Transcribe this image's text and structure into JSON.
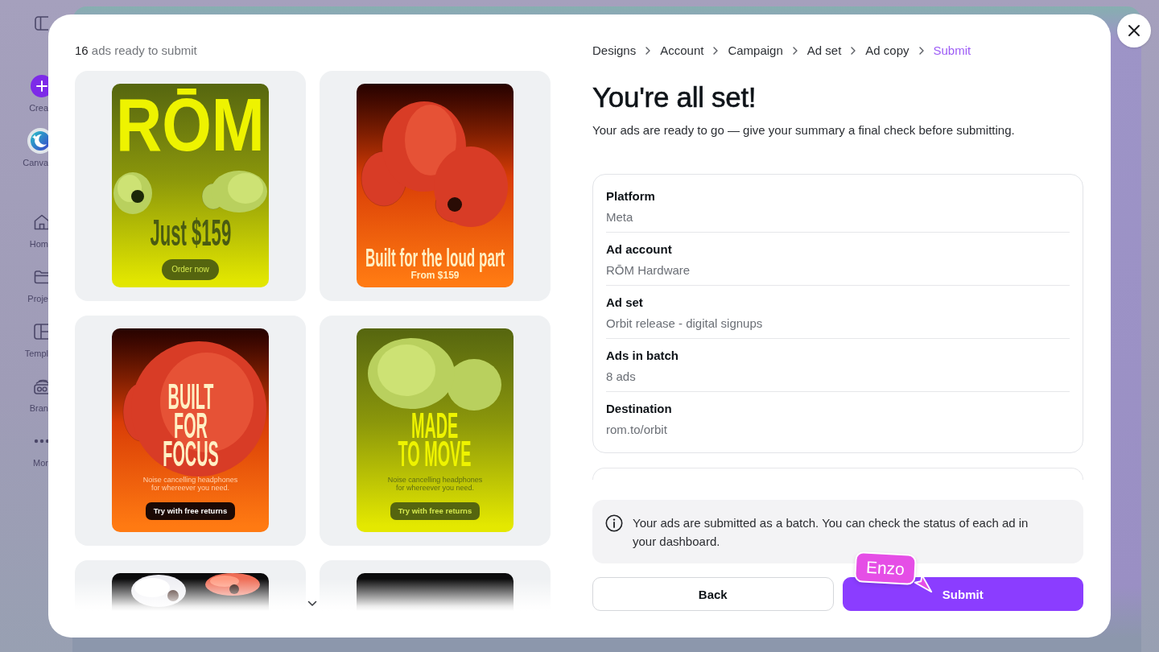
{
  "sidebar": {
    "actions": [
      {
        "label": "Crea",
        "kind": "create"
      },
      {
        "label": "Canva",
        "kind": "assistant"
      }
    ],
    "nav": [
      {
        "label": "Hom",
        "kind": "home"
      },
      {
        "label": "Proje",
        "kind": "projects"
      },
      {
        "label": "Templ",
        "kind": "templates"
      },
      {
        "label": "Bran",
        "kind": "brand"
      },
      {
        "label": "Mor",
        "kind": "more"
      }
    ]
  },
  "dialog": {
    "ads_header": "**16** ads ready to submit",
    "ads": [
      {
        "kind": "brand",
        "color": "#e2e600",
        "brand": "RŌM",
        "headline": "Just $159",
        "button": "Order now"
      },
      {
        "kind": "tagline",
        "color": "#ff7a12",
        "headline": "Built for the loud part",
        "subline": "From $159"
      },
      {
        "kind": "stacked",
        "color": "#ff7a12",
        "headline": "BUILT\nFOR\nFOCUS",
        "body": "Noise cancelling headphones for whereever you need.",
        "button": "Try with free returns"
      },
      {
        "kind": "stacked",
        "color": "#e4e800",
        "headline": "MADE\nTO MOVE",
        "body": "Noise cancelling headphones for whereever you need.",
        "button": "Try with free returns"
      },
      {
        "kind": "photo",
        "color": "#0b0b0c"
      },
      {
        "kind": "photo",
        "color": "#0b0b0c"
      }
    ],
    "breadcrumb": [
      {
        "label": "Designs",
        "selected": false
      },
      {
        "label": "Account",
        "selected": false
      },
      {
        "label": "Campaign",
        "selected": false
      },
      {
        "label": "Ad set",
        "selected": false
      },
      {
        "label": "Ad copy",
        "selected": false
      },
      {
        "label": "Submit",
        "selected": true
      }
    ],
    "title": "You're all set!",
    "subtitle": "Your ads are ready to go — give your summary a final check before submitting.",
    "summary": [
      {
        "label": "Platform",
        "value": "Meta"
      },
      {
        "label": "Ad account",
        "value": "RŌM Hardware"
      },
      {
        "label": "Ad set",
        "value": "Orbit release - digital signups"
      },
      {
        "label": "Ads in batch",
        "value": "8 ads"
      },
      {
        "label": "Destination",
        "value": "rom.to/orbit"
      }
    ],
    "notice": "Your ads are submitted as a batch. You can check the status of each ad in your dashboard.",
    "buttons": [
      {
        "label": "Back",
        "kind": "secondary"
      },
      {
        "label": "Submit",
        "kind": "primary"
      }
    ]
  },
  "collaborator": {
    "name": "Enzo"
  }
}
